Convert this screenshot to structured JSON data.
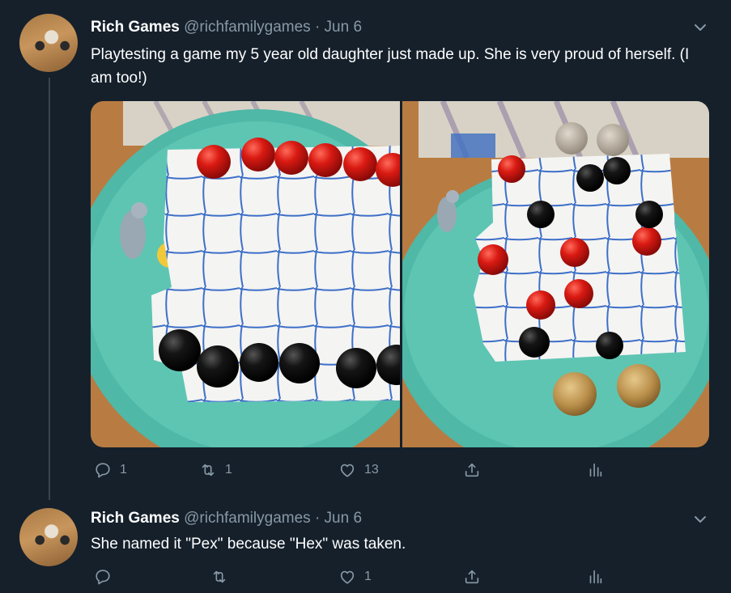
{
  "tweets": [
    {
      "author_name": "Rich Games",
      "handle": "@richfamilygames",
      "separator": "·",
      "date": "Jun 6",
      "text": "Playtesting a game my 5 year old daughter just made up. She is very proud of herself. (I am too!)",
      "actions": {
        "reply": "1",
        "retweet": "1",
        "like": "13"
      }
    },
    {
      "author_name": "Rich Games",
      "handle": "@richfamilygames",
      "separator": "·",
      "date": "Jun 6",
      "text": "She named it \"Pex\" because \"Hex\" was taken.",
      "actions": {
        "reply": "",
        "retweet": "",
        "like": "1"
      }
    }
  ],
  "colors": {
    "background": "#15202b",
    "secondary_text": "#8899a6",
    "thread_line": "#38444d"
  },
  "icons": [
    "reply-icon",
    "retweet-icon",
    "like-icon",
    "share-icon",
    "analytics-icon",
    "chevron-down-icon"
  ]
}
